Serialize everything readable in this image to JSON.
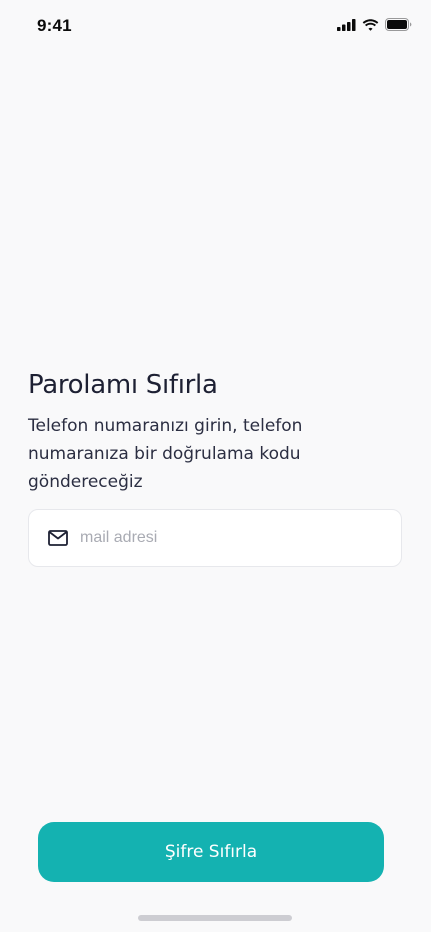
{
  "status_bar": {
    "time": "9:41"
  },
  "screen": {
    "title": "Parolamı Sıfırla",
    "description": "Telefon numaranızı girin, telefon numaranıza bir doğrulama kodu göndereceğiz"
  },
  "email_field": {
    "value": "",
    "placeholder": "mail adresi",
    "icon": "mail-icon"
  },
  "reset_button": {
    "label": "Şifre Sıfırla"
  },
  "colors": {
    "accent": "#14b2b1",
    "background": "#f9f9fa",
    "text": "#1d2033",
    "placeholder": "#a9abb3"
  }
}
